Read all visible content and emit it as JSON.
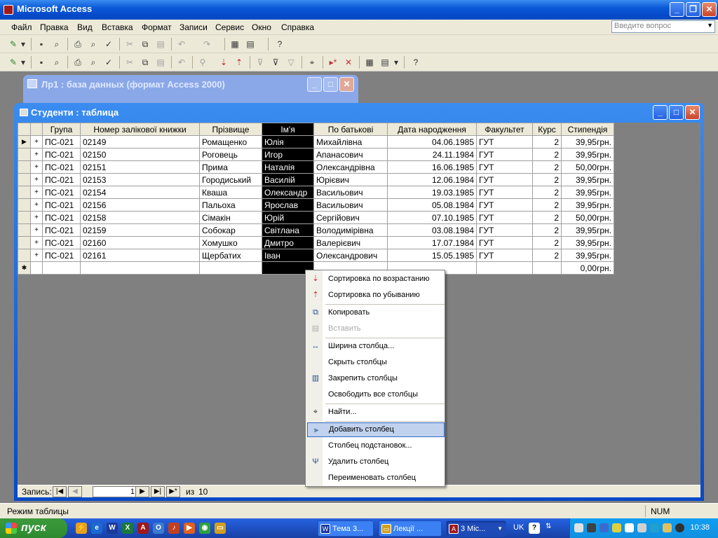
{
  "app": {
    "title": "Microsoft Access"
  },
  "menubar": {
    "items": [
      "Файл",
      "Правка",
      "Вид",
      "Вставка",
      "Формат",
      "Записи",
      "Сервис",
      "Окно",
      "Справка"
    ],
    "ask_placeholder": "Введите вопрос"
  },
  "db_window": {
    "title": "Лр1 : база данных (формат Access 2000)"
  },
  "table_window": {
    "title": "Студенти : таблица"
  },
  "table": {
    "columns": [
      "Група",
      "Номер залікової книжки",
      "Прізвище",
      "Ім'я",
      "По батькові",
      "Дата народження",
      "Факультет",
      "Курс",
      "Стипендія"
    ],
    "rows": [
      [
        "ПС-021",
        "02149",
        "Ромащенко",
        "Юлія",
        "Михайлівна",
        "04.06.1985",
        "ГУТ",
        "2",
        "39,95грн."
      ],
      [
        "ПС-021",
        "02150",
        "Роговець",
        "Игор",
        "Апанасович",
        "24.11.1984",
        "ГУТ",
        "2",
        "39,95грн."
      ],
      [
        "ПС-021",
        "02151",
        "Прима",
        "Наталія",
        "Олександрівна",
        "16.06.1985",
        "ГУТ",
        "2",
        "50,00грн."
      ],
      [
        "ПС-021",
        "02153",
        "Городиський",
        "Василій",
        "Юрієвич",
        "12.06.1984",
        "ГУТ",
        "2",
        "39,95грн."
      ],
      [
        "ПС-021",
        "02154",
        "Кваша",
        "Олександр",
        "Васильович",
        "19.03.1985",
        "ГУТ",
        "2",
        "39,95грн."
      ],
      [
        "ПС-021",
        "02156",
        "Пальоха",
        "Ярослав",
        "Васильович",
        "05.08.1984",
        "ГУТ",
        "2",
        "39,95грн."
      ],
      [
        "ПС-021",
        "02158",
        "Сімакін",
        "Юрій",
        "Сергійович",
        "07.10.1985",
        "ГУТ",
        "2",
        "50,00грн."
      ],
      [
        "ПС-021",
        "02159",
        "Собокар",
        "Світлана",
        "Володимірівна",
        "03.08.1984",
        "ГУТ",
        "2",
        "39,95грн."
      ],
      [
        "ПС-021",
        "02160",
        "Хомушко",
        "Дмитро",
        "Валерієвич",
        "17.07.1984",
        "ГУТ",
        "2",
        "39,95грн."
      ],
      [
        "ПС-021",
        "02161",
        "Щербатих",
        "Іван",
        "Олександрович",
        "15.05.1985",
        "ГУТ",
        "2",
        "39,95грн."
      ]
    ],
    "new_row_default": "0,00грн.",
    "selected_column": "Ім'я"
  },
  "navigation": {
    "label": "Запись:",
    "current": "1",
    "of_label": "из",
    "total": "10"
  },
  "context_menu": {
    "items": [
      {
        "label": "Сортировка по возрастанию",
        "icon": "sort-ascending-icon",
        "enabled": true
      },
      {
        "label": "Сортировка по убыванию",
        "icon": "sort-descending-icon",
        "enabled": true
      },
      {
        "label": "Копировать",
        "icon": "copy-icon",
        "enabled": true
      },
      {
        "label": "Вставить",
        "icon": "paste-icon",
        "enabled": false
      },
      {
        "label": "Ширина столбца...",
        "icon": "column-width-icon",
        "enabled": true
      },
      {
        "label": "Скрыть столбцы",
        "icon": "",
        "enabled": true
      },
      {
        "label": "Закрепить столбцы",
        "icon": "freeze-columns-icon",
        "enabled": true
      },
      {
        "label": "Освободить все столбцы",
        "icon": "",
        "enabled": true
      },
      {
        "label": "Найти...",
        "icon": "find-binoculars-icon",
        "enabled": true
      },
      {
        "label": "Добавить столбец",
        "icon": "insert-column-icon",
        "enabled": true
      },
      {
        "label": "Столбец подстановок...",
        "icon": "",
        "enabled": true
      },
      {
        "label": "Удалить столбец",
        "icon": "delete-column-icon",
        "enabled": true
      },
      {
        "label": "Переименовать столбец",
        "icon": "",
        "enabled": true
      }
    ],
    "highlighted": "Добавить столбец"
  },
  "status": {
    "left": "Режим таблицы",
    "num": "NUM"
  },
  "taskbar": {
    "start_label": "пуск",
    "tasks": [
      {
        "label": "Тема 3..."
      },
      {
        "label": "Лекції ..."
      },
      {
        "label": "3 Mic..."
      }
    ],
    "lang": "UK",
    "clock": "10:38"
  }
}
